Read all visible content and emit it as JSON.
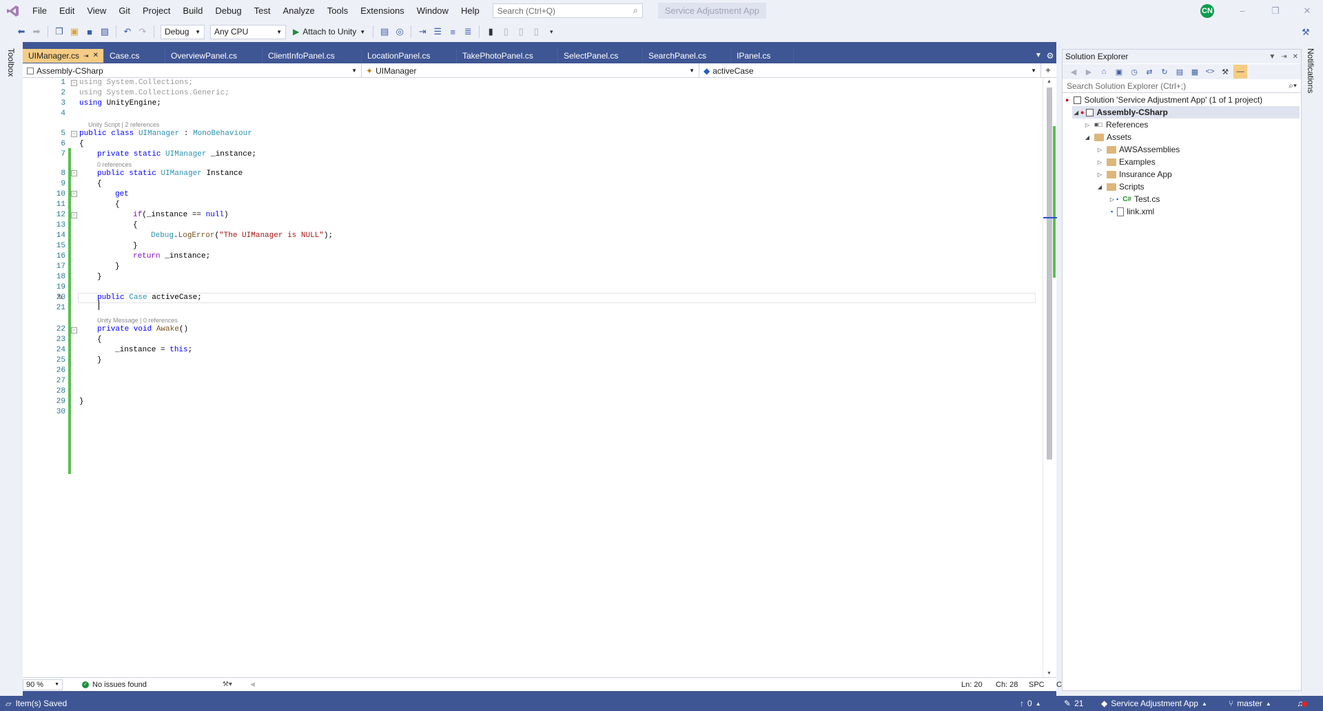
{
  "menu": {
    "items": [
      "File",
      "Edit",
      "View",
      "Git",
      "Project",
      "Build",
      "Debug",
      "Test",
      "Analyze",
      "Tools",
      "Extensions",
      "Window",
      "Help"
    ],
    "search_placeholder": "Search (Ctrl+Q)",
    "app_title": "Service Adjustment App",
    "avatar_initials": "CN"
  },
  "toolbar": {
    "configuration": "Debug",
    "platform": "Any CPU",
    "attach_label": "Attach to Unity"
  },
  "sidebars": {
    "left": "Toolbox",
    "right": "Notifications"
  },
  "tabs": [
    "UIManager.cs",
    "Case.cs",
    "OverviewPanel.cs",
    "ClientInfoPanel.cs",
    "LocationPanel.cs",
    "TakePhotoPanel.cs",
    "SelectPanel.cs",
    "SearchPanel.cs",
    "IPanel.cs"
  ],
  "navbar": {
    "project": "Assembly-CSharp",
    "type": "UIManager",
    "member": "activeCase"
  },
  "code": {
    "l1": "using System.Collections;",
    "l2": "using System.Collections.Generic;",
    "l3_kw": "using",
    "l3_rest": " UnityEngine;",
    "lens5": "Unity Script | 2 references",
    "l5_kw": "public class ",
    "l5_t": "UIManager",
    "l5_c": " : ",
    "l5_b": "MonoBehaviour",
    "l6": "{",
    "l7_kw": "private static ",
    "l7_t": "UIManager",
    "l7_r": " _instance;",
    "lens8": "0 references",
    "l8_kw": "public static ",
    "l8_t": "UIManager",
    "l8_r": " Instance",
    "l9": "{",
    "l10": "get",
    "l11": "{",
    "l12_kw": "if",
    "l12_a": "(_instance == ",
    "l12_n": "null",
    "l12_b": ")",
    "l13": "{",
    "l14_t": "Debug",
    "l14_d": ".",
    "l14_f": "LogError",
    "l14_o": "(",
    "l14_s": "\"The UIManager is NULL\"",
    "l14_e": ");",
    "l15": "}",
    "l16_kw": "return",
    "l16_r": " _instance;",
    "l17": "}",
    "l18": "}",
    "l20_kw": "public ",
    "l20_t": "Case",
    "l20_r": " activeCase;",
    "lens22": "Unity Message | 0 references",
    "l22_kw": "private void ",
    "l22_f": "Awake",
    "l22_r": "()",
    "l23": "{",
    "l24_a": "_instance = ",
    "l24_kw": "this",
    "l24_b": ";",
    "l25": "}",
    "l29": "}"
  },
  "line_numbers": [
    "1",
    "2",
    "3",
    "4",
    "5",
    "6",
    "7",
    "8",
    "9",
    "10",
    "11",
    "12",
    "13",
    "14",
    "15",
    "16",
    "17",
    "18",
    "19",
    "20",
    "21",
    "22",
    "23",
    "24",
    "25",
    "26",
    "27",
    "28",
    "29",
    "30"
  ],
  "editor_status": {
    "zoom": "90 %",
    "issues": "No issues found",
    "line": "Ln: 20",
    "col": "Ch: 28",
    "spacing": "SPC",
    "eol": "CRLF"
  },
  "solution_explorer": {
    "title": "Solution Explorer",
    "search_placeholder": "Search Solution Explorer (Ctrl+;)",
    "solution": "Solution 'Service Adjustment App' (1 of 1 project)",
    "project": "Assembly-CSharp",
    "references": "References",
    "assets": "Assets",
    "aws": "AWSAssemblies",
    "examples": "Examples",
    "insurance": "Insurance App",
    "scripts": "Scripts",
    "test": "Test.cs",
    "link": "link.xml"
  },
  "statusbar": {
    "message": "Item(s) Saved",
    "up_count": "0",
    "edits_count": "21",
    "repo": "Service Adjustment App",
    "branch": "master"
  }
}
